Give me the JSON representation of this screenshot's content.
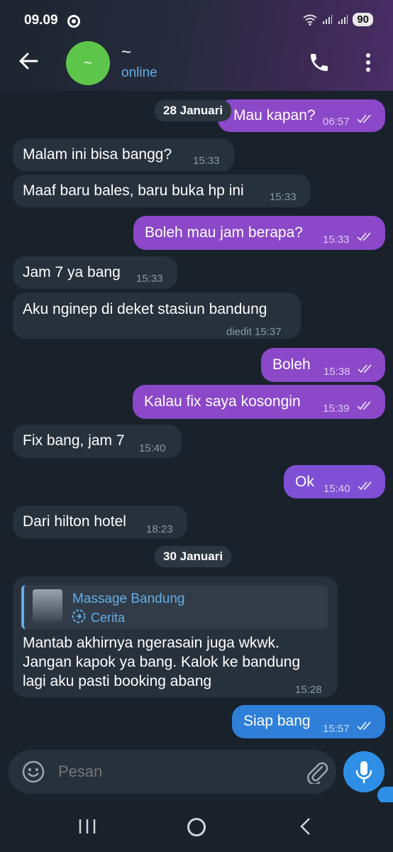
{
  "status_bar": {
    "time": "09.09",
    "battery": "90"
  },
  "header": {
    "contact_name": "~",
    "avatar_initial": "~",
    "status": "online"
  },
  "dates": {
    "d1": "28 Januari",
    "d2": "30 Januari"
  },
  "messages": [
    {
      "dir": "out",
      "text": "Mau kapan?",
      "time": "06:57",
      "read": true
    },
    {
      "dir": "in",
      "text": "Malam ini bisa bangg?",
      "time": "15:33"
    },
    {
      "dir": "in",
      "text": "Maaf baru bales, baru buka hp ini",
      "time": "15:33"
    },
    {
      "dir": "out",
      "text": "Boleh mau jam berapa?",
      "time": "15:33",
      "read": true
    },
    {
      "dir": "in",
      "text": "Jam 7 ya bang",
      "time": "15:33"
    },
    {
      "dir": "in",
      "text": "Aku nginep di deket stasiun bandung",
      "time": "diedit 15:37"
    },
    {
      "dir": "out",
      "text": "Boleh",
      "time": "15:38",
      "read": true
    },
    {
      "dir": "out",
      "text": "Kalau fix saya kosongin",
      "time": "15:39",
      "read": true
    },
    {
      "dir": "in",
      "text": "Fix bang, jam 7",
      "time": "15:40"
    },
    {
      "dir": "out",
      "text": "Ok",
      "time": "15:40",
      "read": true
    },
    {
      "dir": "in",
      "text": "Dari hilton hotel",
      "time": "18:23"
    },
    {
      "dir": "in",
      "reply_title": "Massage Bandung",
      "reply_sub": "Cerita",
      "lines": [
        "Mantab akhirnya ngerasain juga wkwk.",
        "Jangan kapok ya bang. Kalok ke bandung",
        "lagi aku pasti booking abang"
      ],
      "time": "15:28"
    },
    {
      "dir": "out",
      "text": "Siap bang",
      "time": "15:57",
      "read": true
    }
  ],
  "input": {
    "placeholder": "Pesan"
  },
  "colors": {
    "outgoing": "#8b48c9",
    "outgoing_last": "#2f7fd9",
    "incoming": "#27313c",
    "accent": "#63aee8"
  },
  "icons": [
    "back-arrow-icon",
    "phone-icon",
    "more-vert-icon",
    "emoji-icon",
    "attach-icon",
    "mic-icon",
    "story-icon"
  ]
}
